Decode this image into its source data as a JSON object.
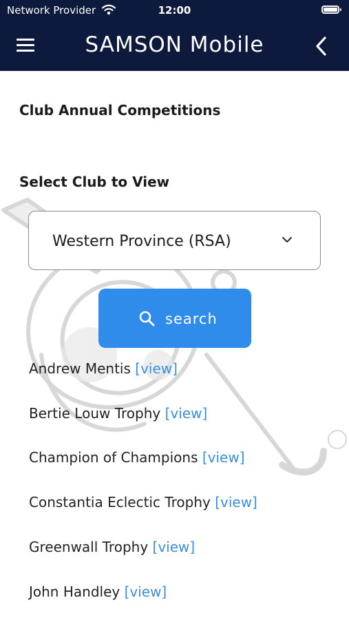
{
  "status_bar": {
    "carrier": "Network Provider",
    "time": "12:00"
  },
  "header": {
    "title": "SAMSON Mobile"
  },
  "content": {
    "heading": "Club Annual Competitions",
    "select_label": "Select Club to View",
    "selected_club": "Western Province (RSA)",
    "search_label": "search",
    "competitions": [
      {
        "name": "Andrew Mentis",
        "link": "[view]"
      },
      {
        "name": "Bertie Louw Trophy",
        "link": "[view]"
      },
      {
        "name": "Champion of Champions",
        "link": "[view]"
      },
      {
        "name": "Constantia Eclectic Trophy",
        "link": "[view]"
      },
      {
        "name": "Greenwall Trophy",
        "link": "[view]"
      },
      {
        "name": "John Handley",
        "link": "[view]"
      }
    ]
  },
  "colors": {
    "header_bg": "#0e1a3d",
    "accent": "#2f8ceb",
    "link": "#3a8fe0"
  },
  "icons": [
    "menu-icon",
    "back-icon",
    "wifi-icon",
    "battery-icon",
    "chevron-down-icon",
    "search-icon"
  ]
}
